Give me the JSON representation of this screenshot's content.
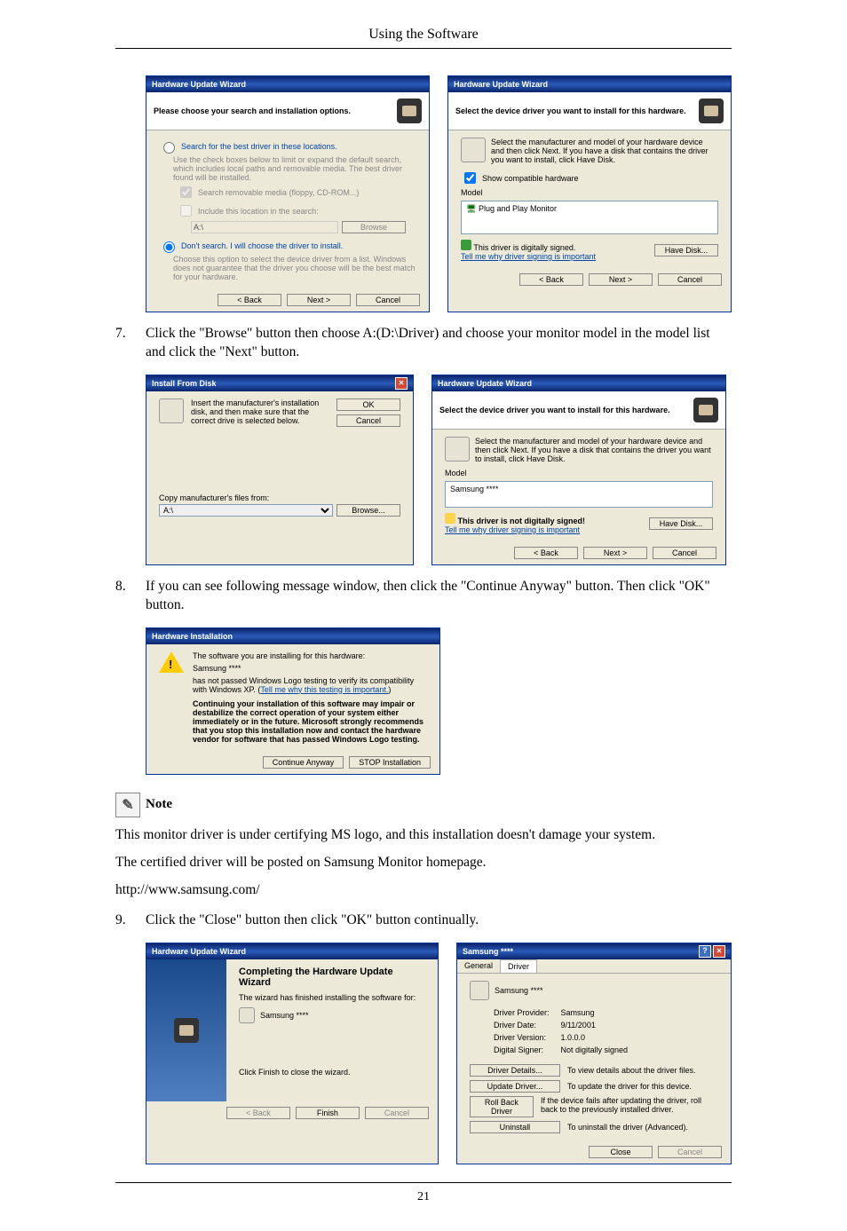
{
  "header": {
    "title": "Using the Software"
  },
  "footer": {
    "page_number": "21"
  },
  "steps": {
    "s7": {
      "num": "7.",
      "text": "Click the \"Browse\" button then choose A:(D:\\Driver) and choose your monitor model in the model list and click the \"Next\" button."
    },
    "s8": {
      "num": "8.",
      "text": "If you can see following message window, then click the \"Continue Anyway\" button. Then click \"OK\" button."
    },
    "s9": {
      "num": "9.",
      "text": "Click the \"Close\" button then click \"OK\" button continually."
    }
  },
  "note": {
    "label": "Note",
    "line1": "This monitor driver is under certifying MS logo, and this installation doesn't damage your system.",
    "line2": "The certified driver will be posted on Samsung Monitor homepage.",
    "line3": "http://www.samsung.com/"
  },
  "wiz_search": {
    "title": "Hardware Update Wizard",
    "banner": "Please choose your search and installation options.",
    "radio1": "Search for the best driver in these locations.",
    "radio1_sub": "Use the check boxes below to limit or expand the default search, which includes local paths and removable media. The best driver found will be installed.",
    "chk1": "Search removable media (floppy, CD-ROM...)",
    "chk2": "Include this location in the search:",
    "path_value": "A:\\",
    "browse": "Browse",
    "radio2": "Don't search. I will choose the driver to install.",
    "radio2_sub": "Choose this option to select the device driver from a list. Windows does not guarantee that the driver you choose will be the best match for your hardware.",
    "back": "< Back",
    "next": "Next >",
    "cancel": "Cancel"
  },
  "wiz_select": {
    "title": "Hardware Update Wizard",
    "banner": "Select the device driver you want to install for this hardware.",
    "instr": "Select the manufacturer and model of your hardware device and then click Next. If you have a disk that contains the driver you want to install, click Have Disk.",
    "show_compat": "Show compatible hardware",
    "model_label": "Model",
    "model_item": "Plug and Play Monitor",
    "signed_text": "This driver is digitally signed.",
    "tell_me": "Tell me why driver signing is important",
    "have_disk": "Have Disk...",
    "back": "< Back",
    "next": "Next >",
    "cancel": "Cancel"
  },
  "install_from_disk": {
    "title": "Install From Disk",
    "instr": "Insert the manufacturer's installation disk, and then make sure that the correct drive is selected below.",
    "ok": "OK",
    "cancel": "Cancel",
    "copy_label": "Copy manufacturer's files from:",
    "path": "A:\\",
    "browse": "Browse..."
  },
  "wiz_select2": {
    "title": "Hardware Update Wizard",
    "banner": "Select the device driver you want to install for this hardware.",
    "instr": "Select the manufacturer and model of your hardware device and then click Next. If you have a disk that contains the driver you want to install, click Have Disk.",
    "model_label": "Model",
    "model_item": "Samsung ****",
    "warn_text": "This driver is not digitally signed!",
    "tell_me": "Tell me why driver signing is important",
    "have_disk": "Have Disk...",
    "back": "< Back",
    "next": "Next >",
    "cancel": "Cancel"
  },
  "hw_install_warning": {
    "title": "Hardware Installation",
    "line1": "The software you are installing for this hardware:",
    "device": "Samsung ****",
    "line2a": "has not passed Windows Logo testing to verify its compatibility with Windows XP. (",
    "line2b": "Tell me why this testing is important.",
    "line2c": ")",
    "bold": "Continuing your installation of this software may impair or destabilize the correct operation of your system either immediately or in the future. Microsoft strongly recommends that you stop this installation now and contact the hardware vendor for software that has passed Windows Logo testing.",
    "continue": "Continue Anyway",
    "stop": "STOP Installation"
  },
  "wiz_complete": {
    "title": "Hardware Update Wizard",
    "heading": "Completing the Hardware Update Wizard",
    "sub": "The wizard has finished installing the software for:",
    "device": "Samsung ****",
    "finish_msg": "Click Finish to close the wizard.",
    "back": "< Back",
    "finish": "Finish",
    "cancel": "Cancel"
  },
  "props": {
    "title": "Samsung ****",
    "tab_general": "General",
    "tab_driver": "Driver",
    "device": "Samsung ****",
    "provider_label": "Driver Provider:",
    "provider": "Samsung",
    "date_label": "Driver Date:",
    "date": "9/11/2001",
    "version_label": "Driver Version:",
    "version": "1.0.0.0",
    "signer_label": "Digital Signer:",
    "signer": "Not digitally signed",
    "details_btn": "Driver Details...",
    "details_txt": "To view details about the driver files.",
    "update_btn": "Update Driver...",
    "update_txt": "To update the driver for this device.",
    "rollback_btn": "Roll Back Driver",
    "rollback_txt": "If the device fails after updating the driver, roll back to the previously installed driver.",
    "uninstall_btn": "Uninstall",
    "uninstall_txt": "To uninstall the driver (Advanced).",
    "close": "Close",
    "cancel": "Cancel"
  }
}
